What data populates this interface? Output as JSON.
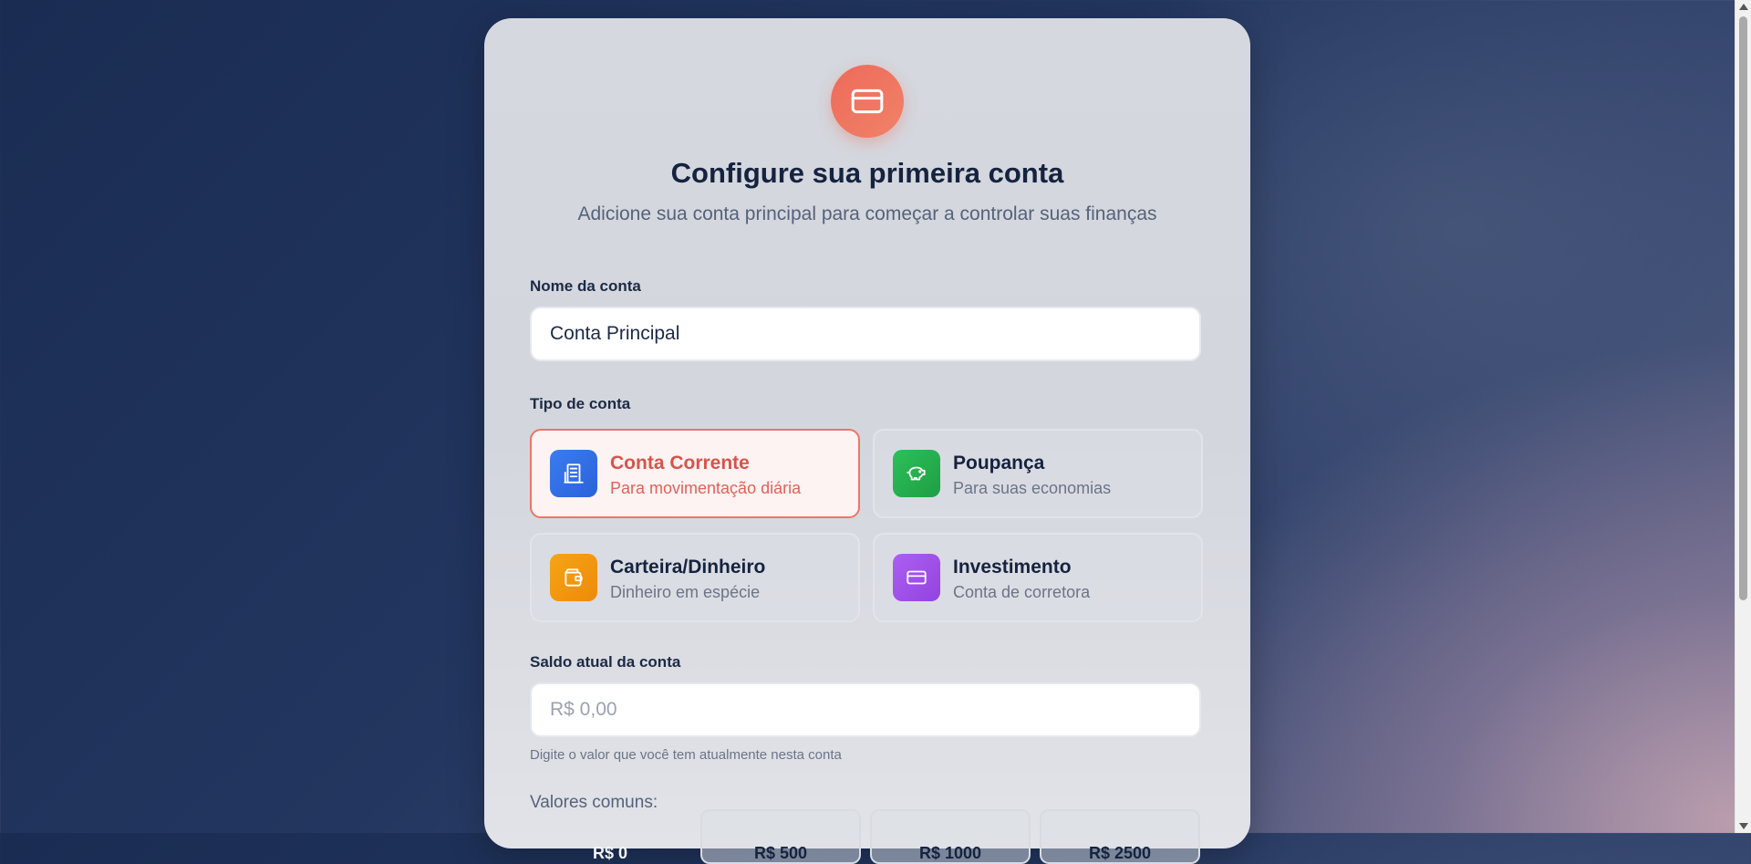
{
  "header": {
    "icon": "credit-card-icon",
    "title": "Configure sua primeira conta",
    "subtitle": "Adicione sua conta principal para começar a controlar suas finanças"
  },
  "account_name": {
    "label": "Nome da conta",
    "value": "Conta Principal"
  },
  "account_type": {
    "label": "Tipo de conta",
    "options": [
      {
        "title": "Conta Corrente",
        "desc": "Para movimentação diária",
        "icon": "building-icon",
        "color": "#2f6fe6",
        "selected": true
      },
      {
        "title": "Poupança",
        "desc": "Para suas economias",
        "icon": "piggy-bank-icon",
        "color": "#22b14c",
        "selected": false
      },
      {
        "title": "Carteira/Dinheiro",
        "desc": "Dinheiro em espécie",
        "icon": "wallet-icon",
        "color": "#f29a0e",
        "selected": false
      },
      {
        "title": "Investimento",
        "desc": "Conta de corretora",
        "icon": "credit-card-icon",
        "color": "#a151e8",
        "selected": false
      }
    ]
  },
  "balance": {
    "label": "Saldo atual da conta",
    "placeholder": "R$ 0,00",
    "hint": "Digite o valor que você tem atualmente nesta conta"
  },
  "common_values": {
    "label": "Valores comuns:",
    "options": [
      "R$ 0",
      "R$ 500",
      "R$ 1000",
      "R$ 2500"
    ]
  },
  "colors": {
    "accent": "#ee6a5a",
    "text": "#15233f"
  }
}
